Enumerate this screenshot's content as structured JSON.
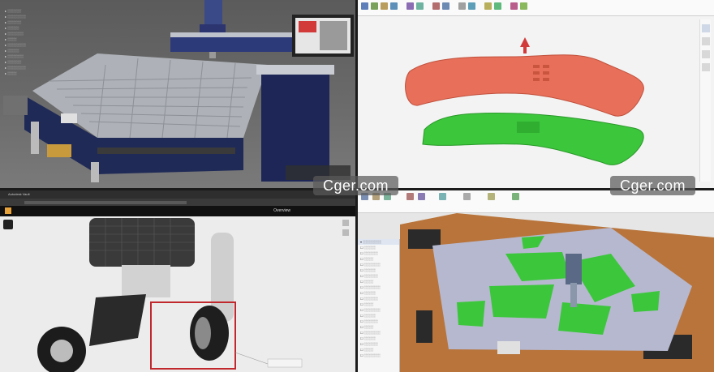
{
  "watermarks": [
    "Cger.com",
    "Cger.com"
  ],
  "q3": {
    "tab_title": "Autodesk Vault",
    "app_title": "Overview"
  },
  "colors": {
    "red_part": "#e8705a",
    "green_part": "#3cc63c",
    "machine_blue": "#1f2a57",
    "wood": "#b8743a"
  }
}
